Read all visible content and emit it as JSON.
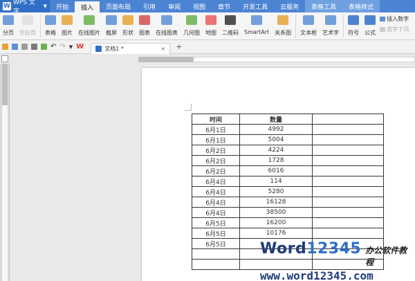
{
  "app": {
    "logo": "W",
    "name": "WPS 文字"
  },
  "menu_tabs": [
    "开始",
    "插入",
    "页面布局",
    "引用",
    "审阅",
    "视图",
    "章节",
    "开发工具",
    "云服务",
    "表格工具",
    "表格样式"
  ],
  "ribbon": {
    "items": [
      {
        "label": "分页",
        "icon": "page-break-icon"
      },
      {
        "label": "空白页",
        "icon": "blank-page-icon"
      },
      {
        "label": "表格",
        "icon": "table-icon"
      },
      {
        "label": "图片",
        "icon": "picture-icon"
      },
      {
        "label": "在线图片",
        "icon": "online-picture-icon"
      },
      {
        "label": "截屏",
        "icon": "screenshot-icon"
      },
      {
        "label": "形状",
        "icon": "shape-icon"
      },
      {
        "label": "图表",
        "icon": "chart-icon"
      },
      {
        "label": "在线图表",
        "icon": "online-chart-icon"
      },
      {
        "label": "几何图",
        "icon": "geometry-icon"
      },
      {
        "label": "地图",
        "icon": "map-icon"
      },
      {
        "label": "二维码",
        "icon": "qrcode-icon"
      },
      {
        "label": "SmartArt",
        "icon": "smartart-icon"
      },
      {
        "label": "关系图",
        "icon": "relation-icon"
      },
      {
        "label": "文本框",
        "icon": "textbox-icon"
      },
      {
        "label": "艺术字",
        "icon": "wordart-icon"
      },
      {
        "label": "符号",
        "icon": "symbol-icon"
      },
      {
        "label": "公式",
        "icon": "formula-icon"
      }
    ],
    "insert_number": "插入数字",
    "dropcap": "首字下沉"
  },
  "doc_tab": {
    "title": "文档1 *",
    "close": "×",
    "plus": "+"
  },
  "table": {
    "headers": [
      "时间",
      "数量",
      ""
    ],
    "rows": [
      [
        "6月1日",
        "4992",
        ""
      ],
      [
        "6月1日",
        "5004",
        ""
      ],
      [
        "6月2日",
        "4224",
        ""
      ],
      [
        "6月2日",
        "1728",
        ""
      ],
      [
        "6月2日",
        "6016",
        ""
      ],
      [
        "6月4日",
        "114",
        ""
      ],
      [
        "6月4日",
        "5280",
        ""
      ],
      [
        "6月4日",
        "16128",
        ""
      ],
      [
        "6月4日",
        "38500",
        ""
      ],
      [
        "6月5日",
        "16200",
        ""
      ],
      [
        "6月5日",
        "10176",
        ""
      ],
      [
        "6月5日",
        "",
        ""
      ],
      [
        "",
        "",
        ""
      ],
      [
        "",
        "",
        ""
      ]
    ]
  },
  "watermark": {
    "brand_word": "Word",
    "brand_num": "12345",
    "cn": "办公软件教程",
    "url": "www.word12345.com"
  }
}
